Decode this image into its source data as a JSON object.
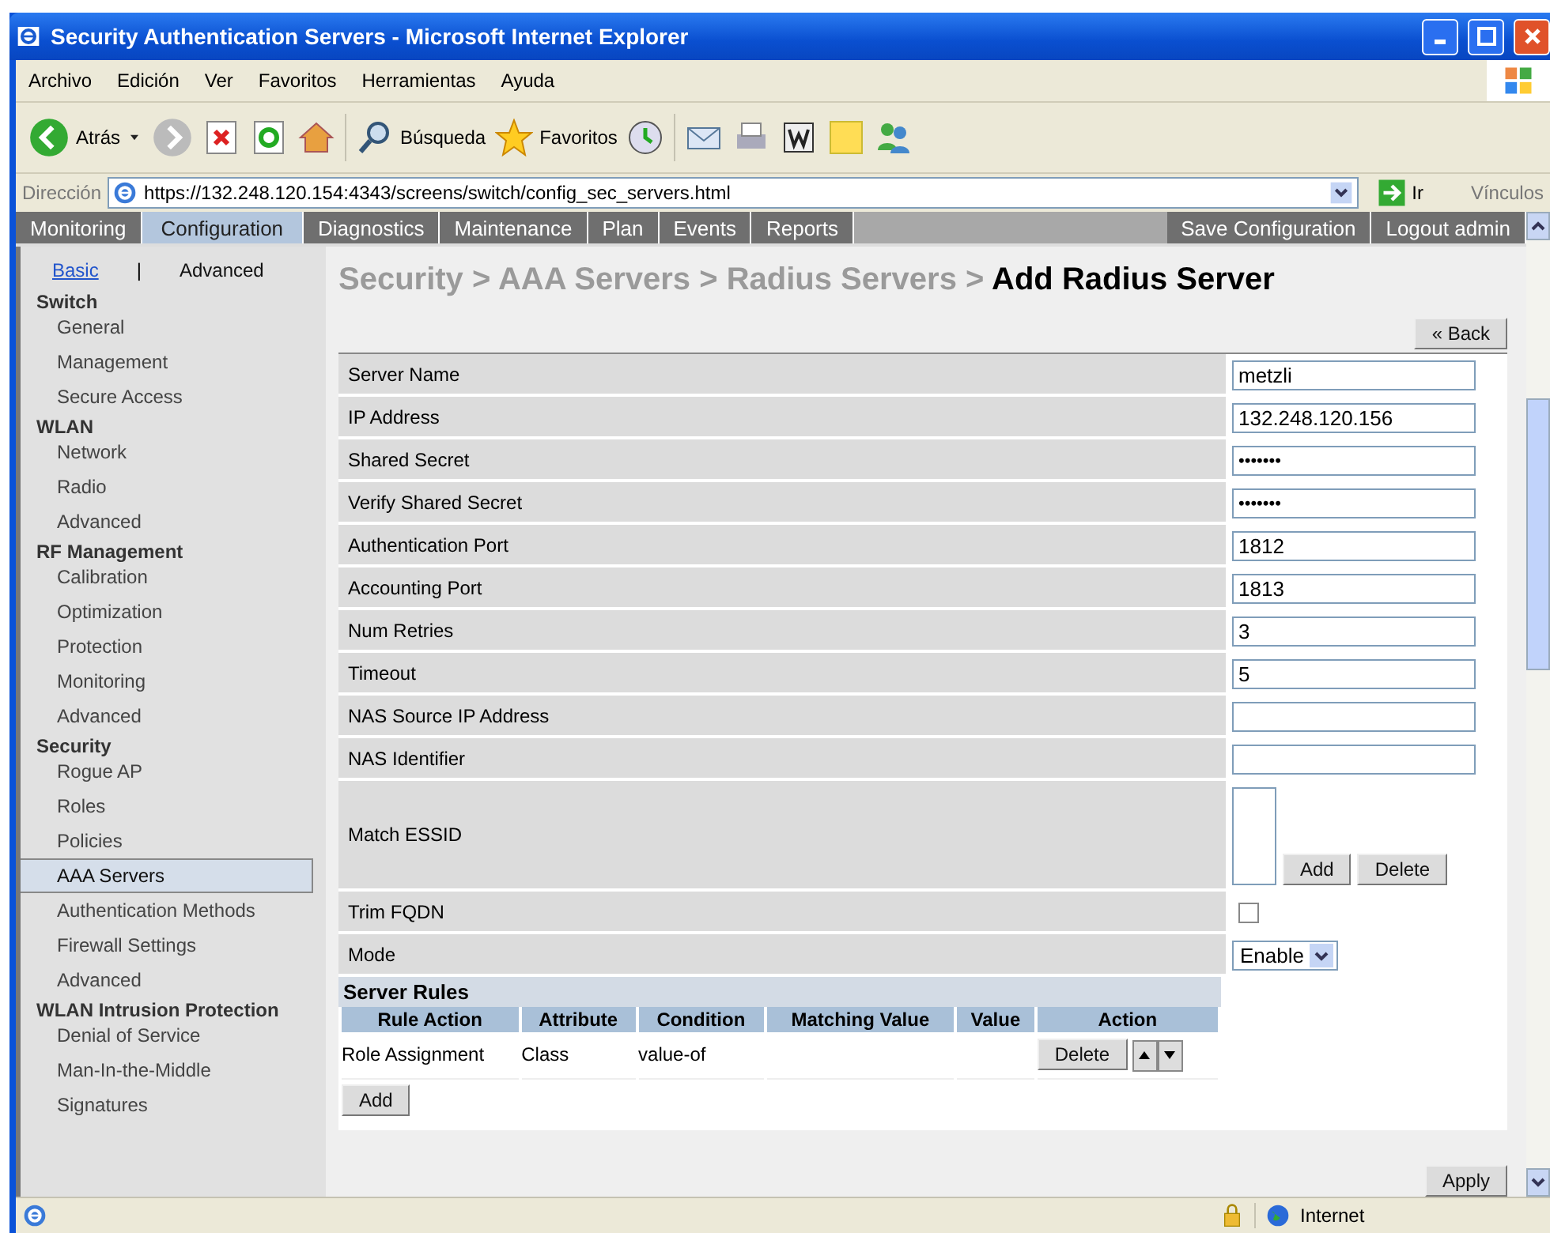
{
  "window": {
    "title": "Security Authentication Servers - Microsoft Internet Explorer"
  },
  "menu": [
    "Archivo",
    "Edición",
    "Ver",
    "Favoritos",
    "Herramientas",
    "Ayuda"
  ],
  "toolbar": {
    "back": "Atrás",
    "search": "Búsqueda",
    "favorites": "Favoritos"
  },
  "address_bar": {
    "label": "Dirección",
    "url": "https://132.248.120.154:4343/screens/switch/config_sec_servers.html",
    "go": "Ir",
    "links": "Vínculos"
  },
  "nav_tabs": [
    {
      "label": "Monitoring",
      "selected": false
    },
    {
      "label": "Configuration",
      "selected": true
    },
    {
      "label": "Diagnostics",
      "selected": false
    },
    {
      "label": "Maintenance",
      "selected": false
    },
    {
      "label": "Plan",
      "selected": false
    },
    {
      "label": "Events",
      "selected": false
    },
    {
      "label": "Reports",
      "selected": false
    }
  ],
  "nav_actions": [
    "Save Configuration",
    "Logout admin"
  ],
  "sidebar": {
    "mode_separator": "|",
    "modes": [
      {
        "label": "Basic",
        "selected": false
      },
      {
        "label": "Advanced",
        "selected": true
      }
    ],
    "sections": [
      {
        "title": "Switch",
        "items": [
          {
            "label": "General",
            "selected": false
          },
          {
            "label": "Management",
            "selected": false
          },
          {
            "label": "Secure Access",
            "selected": false
          }
        ]
      },
      {
        "title": "WLAN",
        "items": [
          {
            "label": "Network",
            "selected": false
          },
          {
            "label": "Radio",
            "selected": false
          },
          {
            "label": "Advanced",
            "selected": false
          }
        ]
      },
      {
        "title": "RF Management",
        "items": [
          {
            "label": "Calibration",
            "selected": false
          },
          {
            "label": "Optimization",
            "selected": false
          },
          {
            "label": "Protection",
            "selected": false
          },
          {
            "label": "Monitoring",
            "selected": false
          },
          {
            "label": "Advanced",
            "selected": false
          }
        ]
      },
      {
        "title": "Security",
        "items": [
          {
            "label": "Rogue AP",
            "selected": false
          },
          {
            "label": "Roles",
            "selected": false
          },
          {
            "label": "Policies",
            "selected": false
          },
          {
            "label": "AAA Servers",
            "selected": true
          },
          {
            "label": "Authentication Methods",
            "selected": false
          },
          {
            "label": "Firewall Settings",
            "selected": false
          },
          {
            "label": "Advanced",
            "selected": false
          }
        ]
      },
      {
        "title": "WLAN Intrusion Protection",
        "items": [
          {
            "label": "Denial of Service",
            "selected": false
          },
          {
            "label": "Man-In-the-Middle",
            "selected": false
          },
          {
            "label": "Signatures",
            "selected": false
          }
        ]
      }
    ]
  },
  "breadcrumb": {
    "path": "Security > AAA Servers > Radius Servers >",
    "current": "Add Radius Server"
  },
  "back_button": "« Back",
  "fields": [
    {
      "kind": "text",
      "label": "Server Name",
      "value": "metzli"
    },
    {
      "kind": "text",
      "label": "IP Address",
      "value": "132.248.120.156"
    },
    {
      "kind": "password",
      "label": "Shared Secret",
      "value": "•••••••"
    },
    {
      "kind": "password",
      "label": "Verify Shared Secret",
      "value": "•••••••"
    },
    {
      "kind": "text",
      "label": "Authentication Port",
      "value": "1812"
    },
    {
      "kind": "text",
      "label": "Accounting Port",
      "value": "1813"
    },
    {
      "kind": "text",
      "label": "Num Retries",
      "value": "3"
    },
    {
      "kind": "text",
      "label": "Timeout",
      "value": "5"
    },
    {
      "kind": "text",
      "label": "NAS Source IP Address"
    },
    {
      "kind": "text",
      "label": "NAS Identifier"
    },
    {
      "kind": "list",
      "label": "Match ESSID",
      "buttons": [
        "Add",
        "Delete"
      ]
    },
    {
      "kind": "checkbox",
      "label": "Trim FQDN",
      "checked": false
    },
    {
      "kind": "select",
      "label": "Mode",
      "value": "Enable"
    }
  ],
  "server_rules": {
    "title": "Server Rules",
    "columns": [
      "Rule Action",
      "Attribute",
      "Condition",
      "Matching Value",
      "Value",
      "Action"
    ],
    "rows": [
      {
        "cells": [
          "Role Assignment",
          "Class",
          "value-of",
          ""
        ],
        "button": "Delete"
      }
    ],
    "add_button": "Add"
  },
  "apply_button": "Apply",
  "status_bar": {
    "zone": "Internet"
  }
}
